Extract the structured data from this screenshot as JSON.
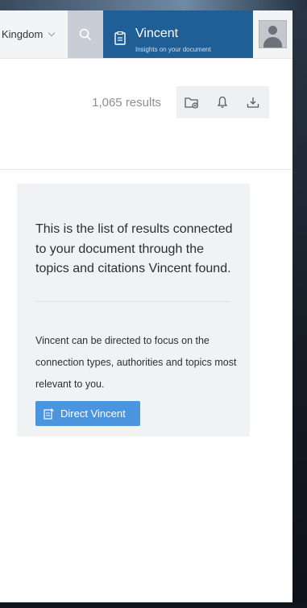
{
  "topbar": {
    "country_label": "Kingdom",
    "search_icon": "search-icon",
    "vincent_name": "Vincent",
    "vincent_subtitle": "Insights on your document",
    "avatar_icon": "user-avatar-icon"
  },
  "results": {
    "count_label": "1,065 results",
    "tools": [
      "folder-add-icon",
      "bell-icon",
      "download-icon"
    ]
  },
  "info_card": {
    "lead": "This is the list of results connected to your document through the topics and citations Vincent found.",
    "description": "Vincent can be directed to focus on the connection types, authorities and topics most relevant to you.",
    "button_label": "Direct Vincent",
    "button_icon": "edit-document-icon"
  },
  "colors": {
    "brand_blue": "#1f5f96",
    "button_blue": "#4b95df",
    "card_bg": "#f1f2f4"
  }
}
